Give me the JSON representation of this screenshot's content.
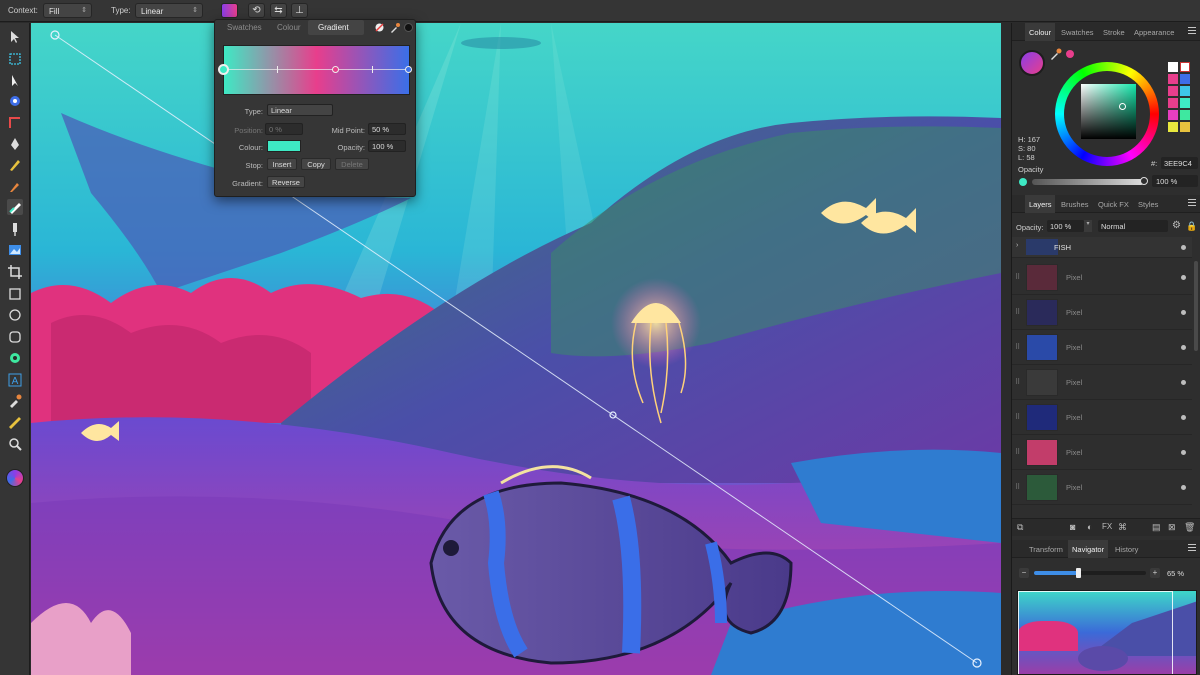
{
  "toolbar": {
    "context_label": "Context:",
    "context_value": "Fill",
    "type_label": "Type:",
    "type_value": "Linear"
  },
  "gradient_panel": {
    "tabs": [
      "Swatches",
      "Colour",
      "Gradient"
    ],
    "active_tab": "Gradient",
    "type_label": "Type:",
    "type_value": "Linear",
    "position_label": "Position:",
    "position_value": "0 %",
    "midpoint_label": "Mid Point:",
    "midpoint_value": "50 %",
    "colour_label": "Colour:",
    "colour_value": "#3EE9C4",
    "opacity_label": "Opacity:",
    "opacity_value": "100 %",
    "stop_label": "Stop:",
    "insert_label": "Insert",
    "copy_label": "Copy",
    "delete_label": "Delete",
    "gradient_label": "Gradient:",
    "reverse_label": "Reverse",
    "gradient_colors": [
      "#3ee9c4",
      "#e83e8c",
      "#3a6fe8"
    ]
  },
  "colour_panel": {
    "tabs": [
      "Colour",
      "Swatches",
      "Stroke",
      "Appearance"
    ],
    "active_tab": "Colour",
    "h": "H: 167",
    "s": "S: 80",
    "l": "L: 58",
    "hex_label": "#:",
    "hex_value": "3EE9C4",
    "opacity_label": "Opacity",
    "opacity_value": "100 %",
    "fill_color": "#3ee9c4",
    "stroke_color": "#e83e8c"
  },
  "layers_panel": {
    "tabs": [
      "Layers",
      "Brushes",
      "Quick FX",
      "Styles"
    ],
    "active_tab": "Layers",
    "opacity_label": "Opacity:",
    "opacity_value": "100 %",
    "blend_mode": "Normal",
    "group_name": "FISH",
    "layers": [
      {
        "name": "Pixel",
        "thumb": "#5a2a3a"
      },
      {
        "name": "Pixel",
        "thumb": "#2a2a5a"
      },
      {
        "name": "Pixel",
        "thumb": "#2a4aa8"
      },
      {
        "name": "Pixel",
        "thumb": "#3a3a3a"
      },
      {
        "name": "Pixel",
        "thumb": "#1f2a7a"
      },
      {
        "name": "Pixel",
        "thumb": "#c23d6a"
      },
      {
        "name": "Pixel",
        "thumb": "#2c5a3a"
      }
    ]
  },
  "navigator_panel": {
    "tabs": [
      "Transform",
      "Navigator",
      "History"
    ],
    "active_tab": "Navigator",
    "zoom_value": "65 %",
    "zoom_level": 0.65
  }
}
